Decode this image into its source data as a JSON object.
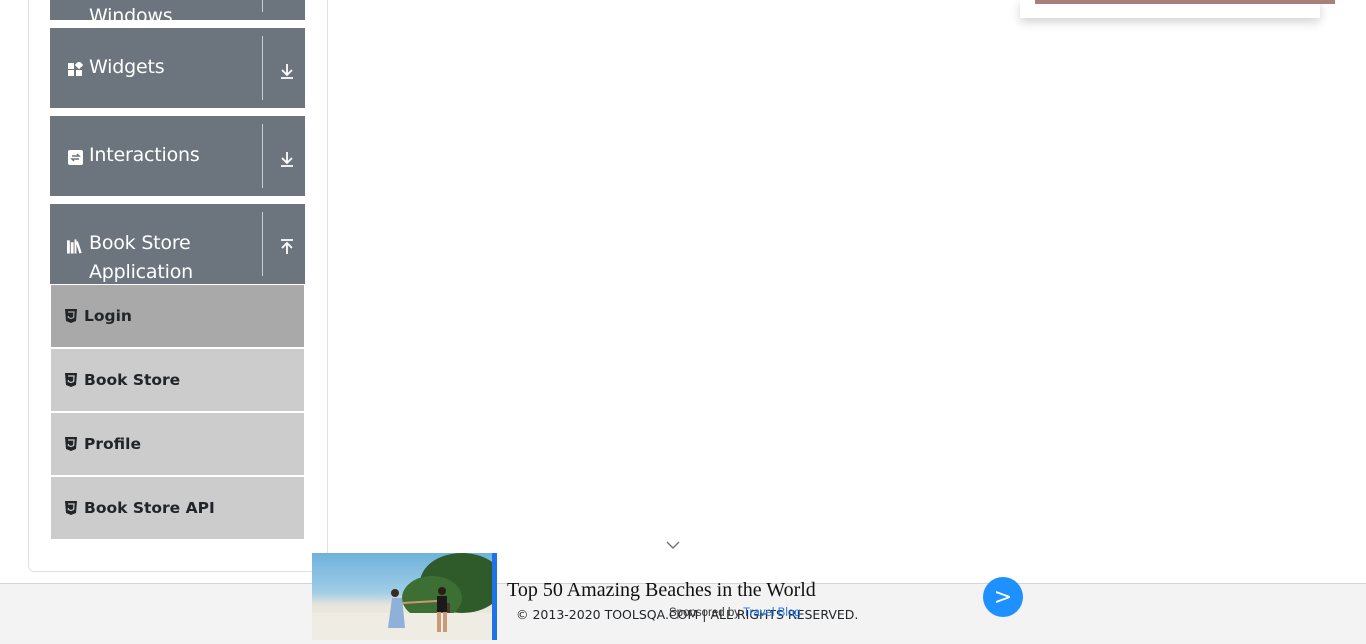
{
  "sidebar": {
    "groups": [
      {
        "label": "Windows",
        "icon": "window-icon",
        "toggle_icon": "download-arrow-icon"
      },
      {
        "label": "Widgets",
        "icon": "widgets-icon",
        "toggle_icon": "download-arrow-icon"
      },
      {
        "label": "Interactions",
        "icon": "interactions-icon",
        "toggle_icon": "download-arrow-icon"
      },
      {
        "label": "Book Store",
        "label_line2": "Application",
        "icon": "books-icon",
        "toggle_icon": "upload-arrow-icon"
      }
    ],
    "items": [
      {
        "label": "Login",
        "icon": "html5-icon",
        "active": true
      },
      {
        "label": "Book Store",
        "icon": "html5-icon",
        "active": false
      },
      {
        "label": "Profile",
        "icon": "html5-icon",
        "active": false
      },
      {
        "label": "Book Store API",
        "icon": "html5-icon",
        "active": false
      }
    ]
  },
  "footer": {
    "copyright": "© 2013-2020 TOOLSQA.COM | ALL RIGHTS RESERVED."
  },
  "ad": {
    "headline": "Top 50 Amazing Beaches in the World",
    "sponsored_prefix": "Sponsored by ",
    "sponsored_brand": "Travel Blog",
    "go_label": ">"
  },
  "colors": {
    "group_bg": "#6c757d",
    "item_bg": "#cccccc",
    "item_active_bg": "#a9a9a9",
    "accent": "#1e90ff"
  }
}
